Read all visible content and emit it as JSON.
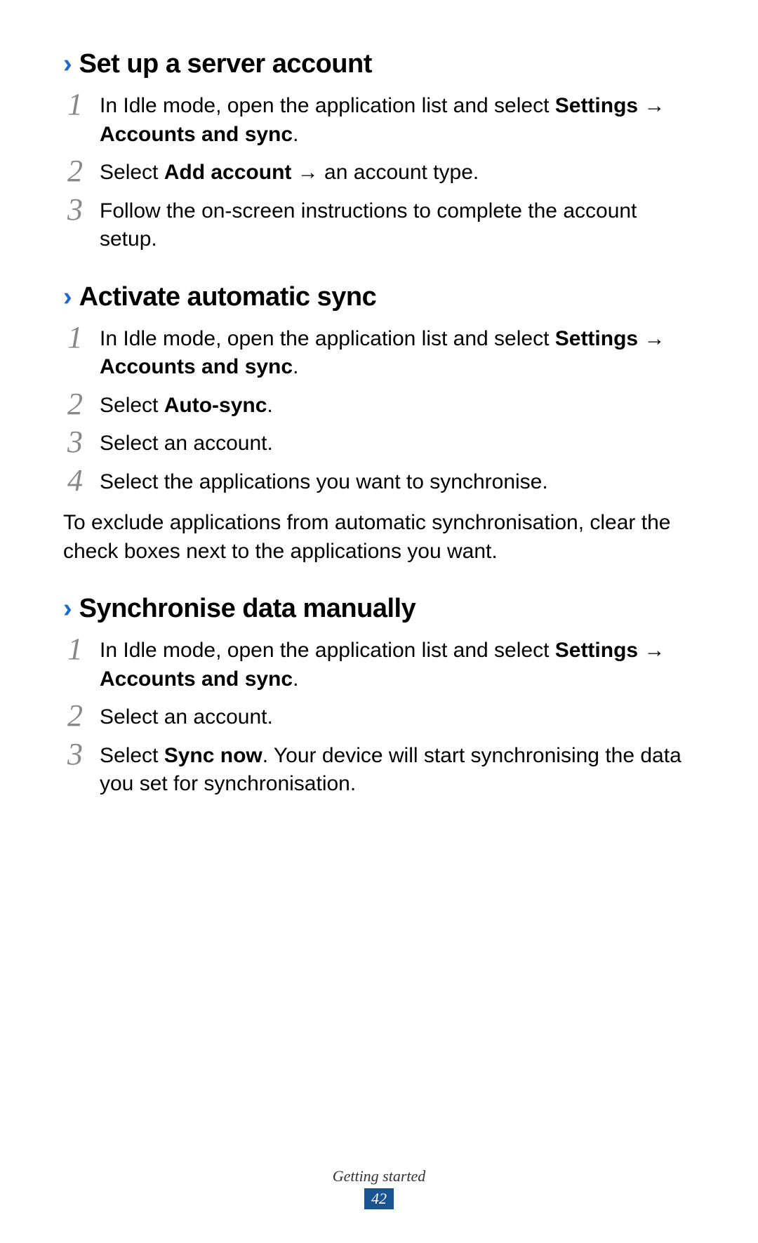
{
  "sections": [
    {
      "heading": "Set up a server account",
      "steps": [
        {
          "num": "1",
          "parts": [
            {
              "text": "In Idle mode, open the application list and select ",
              "bold": false
            },
            {
              "text": "Settings",
              "bold": true
            },
            {
              "text": " → ",
              "bold": false
            },
            {
              "text": "Accounts and sync",
              "bold": true
            },
            {
              "text": ".",
              "bold": false
            }
          ]
        },
        {
          "num": "2",
          "parts": [
            {
              "text": "Select ",
              "bold": false
            },
            {
              "text": "Add account",
              "bold": true
            },
            {
              "text": " → an account type.",
              "bold": false
            }
          ]
        },
        {
          "num": "3",
          "parts": [
            {
              "text": "Follow the on-screen instructions to complete the account setup.",
              "bold": false
            }
          ]
        }
      ],
      "paragraph": null
    },
    {
      "heading": "Activate automatic sync",
      "steps": [
        {
          "num": "1",
          "parts": [
            {
              "text": "In Idle mode, open the application list and select ",
              "bold": false
            },
            {
              "text": "Settings",
              "bold": true
            },
            {
              "text": " → ",
              "bold": false
            },
            {
              "text": "Accounts and sync",
              "bold": true
            },
            {
              "text": ".",
              "bold": false
            }
          ]
        },
        {
          "num": "2",
          "parts": [
            {
              "text": "Select ",
              "bold": false
            },
            {
              "text": "Auto-sync",
              "bold": true
            },
            {
              "text": ".",
              "bold": false
            }
          ]
        },
        {
          "num": "3",
          "parts": [
            {
              "text": "Select an account.",
              "bold": false
            }
          ]
        },
        {
          "num": "4",
          "parts": [
            {
              "text": "Select the applications you want to synchronise.",
              "bold": false
            }
          ]
        }
      ],
      "paragraph": "To exclude applications from automatic synchronisation, clear the check boxes next to the applications you want."
    },
    {
      "heading": "Synchronise data manually",
      "steps": [
        {
          "num": "1",
          "parts": [
            {
              "text": "In Idle mode, open the application list and select ",
              "bold": false
            },
            {
              "text": "Settings",
              "bold": true
            },
            {
              "text": " → ",
              "bold": false
            },
            {
              "text": "Accounts and sync",
              "bold": true
            },
            {
              "text": ".",
              "bold": false
            }
          ]
        },
        {
          "num": "2",
          "parts": [
            {
              "text": "Select an account.",
              "bold": false
            }
          ]
        },
        {
          "num": "3",
          "parts": [
            {
              "text": "Select ",
              "bold": false
            },
            {
              "text": "Sync now",
              "bold": true
            },
            {
              "text": ". Your device will start synchronising the data you set for synchronisation.",
              "bold": false
            }
          ]
        }
      ],
      "paragraph": null
    }
  ],
  "footer": {
    "chapter": "Getting started",
    "page": "42"
  },
  "chevron": "›"
}
